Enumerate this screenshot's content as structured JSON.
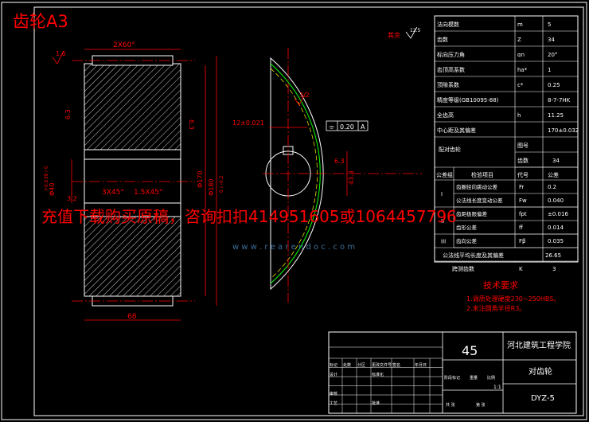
{
  "title": "齿轮A3",
  "front_view": {
    "chamfer_top": "2X60°",
    "rough_left": "1.6",
    "rough_bore": "6.3",
    "rough_side": "3.2",
    "rough_right": "6.3",
    "chamfer_lower": "3X45°",
    "chamfer_lower2": "1.5X45°",
    "dim_bore": "Φ40",
    "dim_bore_tol": "+0.039 / 0",
    "dim_root": "Φ170",
    "dim_tip": "Φ180",
    "dim_tip_tol": "0 / -0.2",
    "dim_width": "68"
  },
  "side_view": {
    "keyway_width": "12±0.021",
    "tol_symbol": "⌯",
    "tol_value": "0.20",
    "datum": "A",
    "keyway_depth": "43.3",
    "rough_key": "3.2",
    "rough_bore2": "6.3"
  },
  "rough_rest": {
    "label": "其余",
    "value": "12.5"
  },
  "params": {
    "rows": [
      {
        "name": "法向模数",
        "sym": "m",
        "val": "5"
      },
      {
        "name": "齿数",
        "sym": "Z",
        "val": "34"
      },
      {
        "name": "标向压力角",
        "sym": "αn",
        "val": "20°"
      },
      {
        "name": "齿顶高系数",
        "sym": "ha*",
        "val": "1"
      },
      {
        "name": "顶隙系数",
        "sym": "c*",
        "val": "0.25"
      },
      {
        "name": "精度等级(GB10095-88)",
        "sym": "",
        "val": "8-7-7HK"
      },
      {
        "name": "全齿高",
        "sym": "h",
        "val": "11.25"
      },
      {
        "name": "中心距及其偏差",
        "sym": "",
        "val": "170±0.032"
      }
    ],
    "pair_label": "配对齿轮",
    "pair_rows": [
      {
        "name": "图号",
        "val": ""
      },
      {
        "name": "齿数",
        "val": "34"
      }
    ],
    "group_header": "公差组",
    "check_header": "检验项目",
    "code_header": "代号",
    "tol_header": "公差",
    "groups": [
      {
        "group": "I",
        "items": [
          {
            "name": "齿圈径向跳动公差",
            "sym": "Fr",
            "val": "0.2"
          },
          {
            "name": "公法线长度变动公差",
            "sym": "Fw",
            "val": "0.040"
          }
        ]
      },
      {
        "group": "II",
        "items": [
          {
            "name": "齿距极限偏差",
            "sym": "fpt",
            "val": "±0.016"
          },
          {
            "name": "齿形公差",
            "sym": "ff",
            "val": "0.014"
          }
        ]
      },
      {
        "group": "III",
        "items": [
          {
            "name": "齿向公差",
            "sym": "Fβ",
            "val": "0.035"
          }
        ]
      }
    ],
    "wk_label": "公法线平均长度及其偏差",
    "wk_val": "26.65",
    "span_label": "跨测齿数",
    "span_sym": "K",
    "span_val": "3"
  },
  "tech": {
    "heading": "技术要求",
    "lines": [
      "1.调质处理硬度230~250HBS。",
      "2.未注圆角半径R3。"
    ]
  },
  "watermark": {
    "text": "充值下载购买原稿，咨询扣扣414951605或1064457796",
    "url": "w w w . r e a r e n d o c . c o m"
  },
  "title_block": {
    "material": "45",
    "school": "河北建筑工程学院",
    "part_name": "对齿轮",
    "drawing_no": "DYZ-5",
    "scale": "1:1",
    "labels": [
      "标记",
      "处数",
      "分区",
      "更改文件号",
      "签名",
      "年月日",
      "设计",
      "标准化",
      "审核",
      "工艺",
      "批准",
      "阶段标记",
      "重量",
      "比例",
      "共 张",
      "第 张"
    ]
  },
  "colors": {
    "bg": "#000000",
    "frame": "#ffffff",
    "dim": "#ff0000",
    "center": "#ff0000",
    "ring": "#00ff00",
    "pitch": "#ffff00",
    "title": "#ff0000",
    "watermark": "#ff0000",
    "table_text": "#ffffff"
  }
}
